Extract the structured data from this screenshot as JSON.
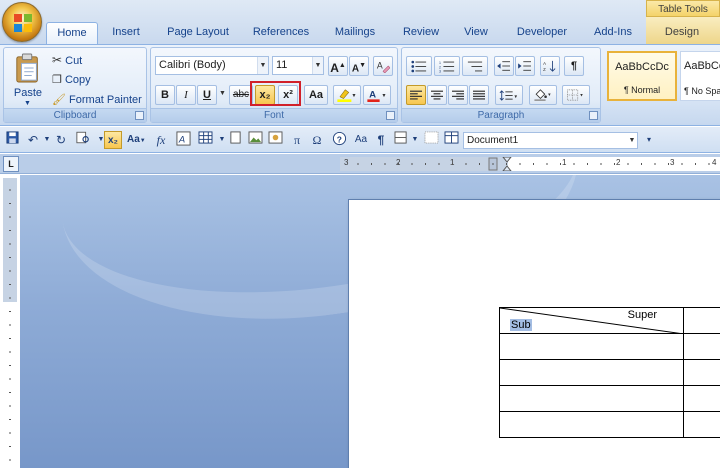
{
  "tabs": [
    "Home",
    "Insert",
    "Page Layout",
    "References",
    "Mailings",
    "Review",
    "View",
    "Developer",
    "Add-Ins",
    "Design"
  ],
  "table_tools_label": "Table Tools",
  "clipboard": {
    "paste_label": "Paste",
    "cut_label": "Cut",
    "copy_label": "Copy",
    "format_painter_label": "Format Painter",
    "group_label": "Clipboard"
  },
  "font": {
    "font_name": "Calibri (Body)",
    "font_size": "11",
    "group_label": "Font",
    "bold": "B",
    "italic": "I",
    "underline": "U",
    "strike": "abc",
    "subscript": "x₂",
    "superscript": "x²",
    "change_case": "Aa",
    "grow": "A",
    "shrink": "A"
  },
  "paragraph": {
    "group_label": "Paragraph",
    "pilcrow": "¶"
  },
  "styles": [
    {
      "preview": "AaBbCcDc",
      "name": "¶ Normal"
    },
    {
      "preview": "AaBbCc",
      "name": "¶ No Spa"
    }
  ],
  "qat": {
    "document_name": "Document1",
    "pi": "π",
    "omega": "Ω",
    "pilcrow": "¶",
    "aa": "Aa",
    "fx": "fx"
  },
  "ruler": {
    "corner": "L",
    "numbers": [
      "3",
      "2",
      "1",
      "1",
      "2",
      "3",
      "4"
    ]
  },
  "table": {
    "super_text": "Super",
    "sub_text": "Sub",
    "rows": 5
  },
  "colors": {
    "accent": "#15428b",
    "highlight_box": "#d1202a",
    "selection": "#a3bde3"
  }
}
